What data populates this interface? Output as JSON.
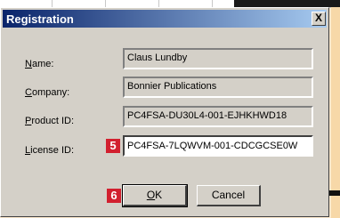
{
  "dialog": {
    "title": "Registration",
    "close_glyph": "X"
  },
  "fields": {
    "name": {
      "label_prefix": "N",
      "label_rest": "ame:",
      "value": "Claus Lundby"
    },
    "company": {
      "label_prefix": "C",
      "label_rest": "ompany:",
      "value": "Bonnier Publications"
    },
    "product_id": {
      "label_prefix": "P",
      "label_rest": "roduct ID:",
      "value": "PC4FSA-DU30L4-001-EJHKHWD18"
    },
    "license_id": {
      "label_prefix": "L",
      "label_rest": "icense ID:",
      "value": "PC4FSA-7LQWVM-001-CDCGCSE0W"
    }
  },
  "markers": {
    "license": "5",
    "ok": "6"
  },
  "buttons": {
    "ok": {
      "label_prefix": "O",
      "label_rest": "K"
    },
    "cancel": {
      "label": "Cancel"
    }
  },
  "colors": {
    "titlebar_start": "#0a246a",
    "titlebar_end": "#a6caf0",
    "marker": "#d2202f",
    "dialog_bg": "#d4d0c8"
  }
}
